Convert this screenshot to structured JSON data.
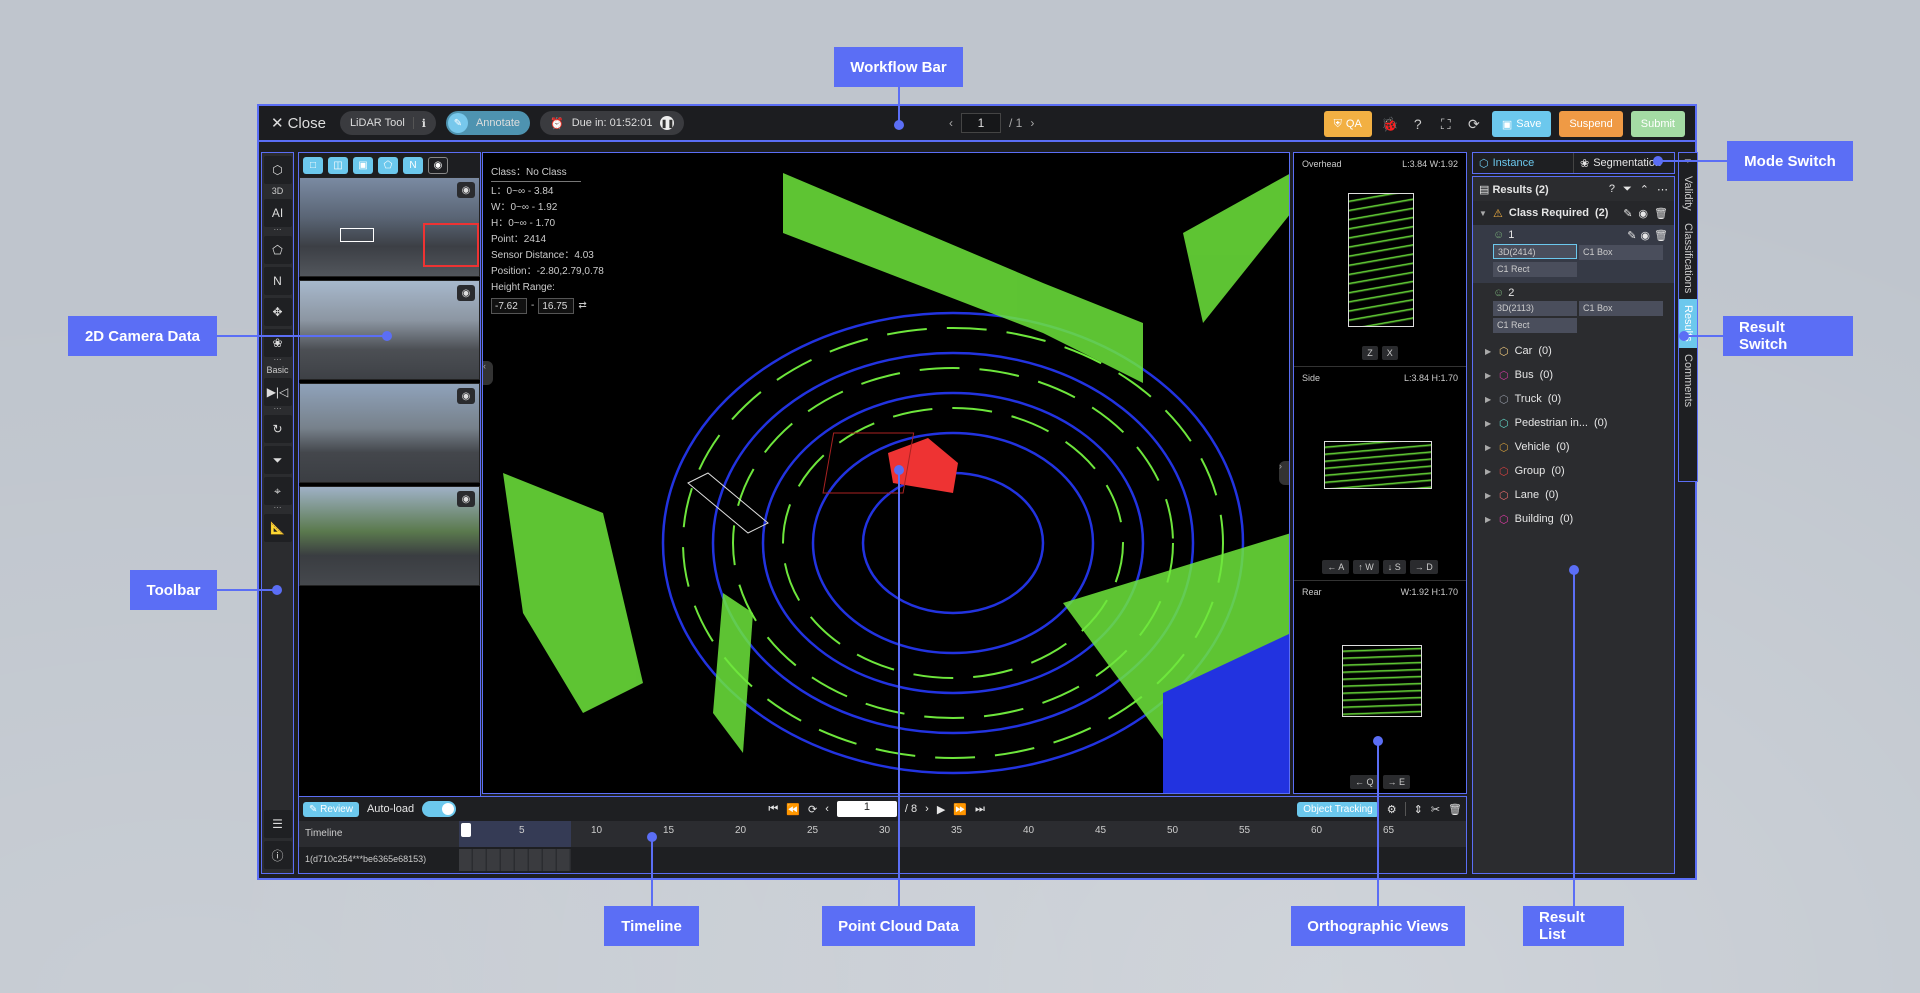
{
  "callouts": {
    "workflow_bar": "Workflow Bar",
    "mode_switch": "Mode Switch",
    "camera_data": "2D Camera Data",
    "result_switch": "Result Switch",
    "toolbar": "Toolbar",
    "timeline": "Timeline",
    "point_cloud": "Point Cloud Data",
    "ortho_views": "Orthographic Views",
    "result_list": "Result List"
  },
  "topbar": {
    "close_label": "Close",
    "tool_name": "LiDAR Tool",
    "mode_label": "Annotate",
    "due_label": "Due in: 01:52:01",
    "page_current": "1",
    "page_total": "/ 1",
    "qa_label": "QA",
    "save_label": "Save",
    "suspend_label": "Suspend",
    "submit_label": "Submit"
  },
  "toolbar": {
    "section_3d": "3D",
    "section_basic": "Basic",
    "ai_label": "AI"
  },
  "info": {
    "class": "Class：No Class",
    "l": "L：0~∞ - 3.84",
    "w": "W：0~∞ - 1.92",
    "h": "H：0~∞ - 1.70",
    "point": "Point：2414",
    "sensor_distance": "Sensor Distance：4.03",
    "position": "Position：-2.80,2.79,0.78",
    "height_range_label": "Height Range:",
    "height_min": "-7.62",
    "height_max": "16.75"
  },
  "ortho": {
    "overhead": {
      "title": "Overhead",
      "dims": "L:3.84 W:1.92",
      "buttons": [
        "Z",
        "X"
      ]
    },
    "side": {
      "title": "Side",
      "dims": "L:3.84 H:1.70",
      "buttons": [
        "← A",
        "↑ W",
        "↓ S",
        "→ D"
      ]
    },
    "rear": {
      "title": "Rear",
      "dims": "W:1.92 H:1.70",
      "buttons": [
        "← Q",
        "→ E"
      ]
    }
  },
  "timeline": {
    "review_label": "Review",
    "autoload_label": "Auto-load",
    "frame_current": "1",
    "frame_total": "/ 8",
    "object_tracking_label": "Object Tracking",
    "timeline_label": "Timeline",
    "track_label": "1(d710c254***be6365e68153)",
    "ticks": [
      "5",
      "10",
      "15",
      "20",
      "25",
      "30",
      "35",
      "40",
      "45",
      "50",
      "55",
      "60",
      "65"
    ]
  },
  "modes": {
    "instance": "Instance",
    "segmentation": "Segmentation"
  },
  "results": {
    "title": "Results (2)",
    "group_label": "Class Required",
    "group_count": "(2)",
    "instances": [
      {
        "id": "1",
        "chips": [
          "3D(2414)",
          "C1 Box",
          "C1 Rect"
        ]
      },
      {
        "id": "2",
        "chips": [
          "3D(2113)",
          "C1 Box",
          "C1 Rect"
        ]
      }
    ],
    "classes": [
      {
        "name": "Car",
        "count": "(0)",
        "color": "#e6c27a"
      },
      {
        "name": "Bus",
        "count": "(0)",
        "color": "#c83a9a"
      },
      {
        "name": "Truck",
        "count": "(0)",
        "color": "#8a8f9a"
      },
      {
        "name": "Pedestrian in...",
        "count": "(0)",
        "color": "#5fd0c0"
      },
      {
        "name": "Vehicle",
        "count": "(0)",
        "color": "#c8963a"
      },
      {
        "name": "Group",
        "count": "(0)",
        "color": "#d04040"
      },
      {
        "name": "Lane",
        "count": "(0)",
        "color": "#e06a6a"
      },
      {
        "name": "Building",
        "count": "(0)",
        "color": "#d83aa0"
      }
    ]
  },
  "side_tabs": [
    "Validity",
    "Classifications",
    "Results",
    "Comments"
  ]
}
